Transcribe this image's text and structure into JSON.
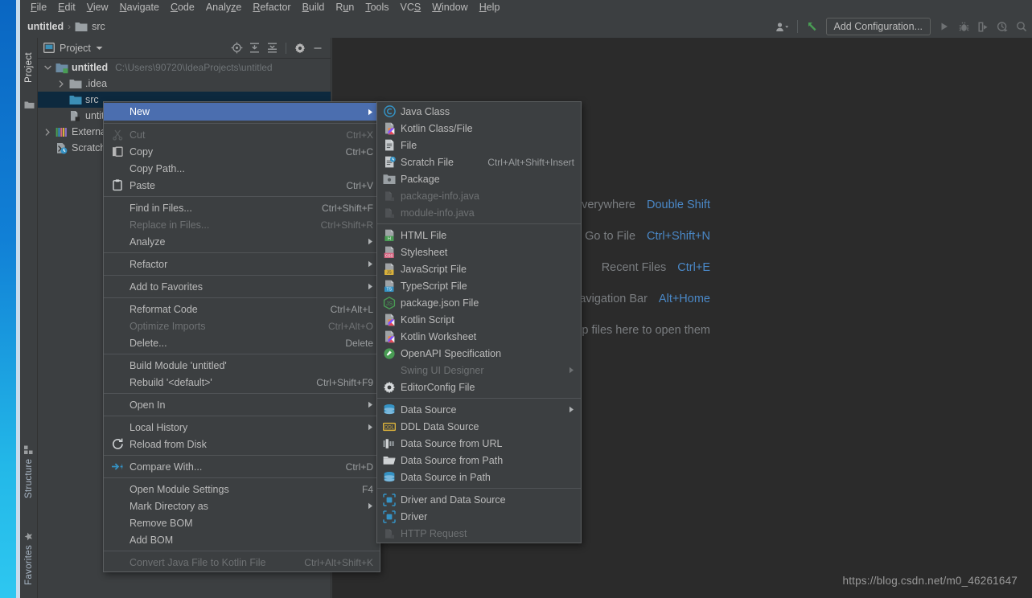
{
  "app": {
    "watermark": "https://blog.csdn.net/m0_46261647"
  },
  "menubar": {
    "items": [
      {
        "label": "File",
        "mnemonic": "F"
      },
      {
        "label": "Edit",
        "mnemonic": "E"
      },
      {
        "label": "View",
        "mnemonic": "V"
      },
      {
        "label": "Navigate",
        "mnemonic": "N"
      },
      {
        "label": "Code",
        "mnemonic": "C"
      },
      {
        "label": "Analyze",
        "mnemonic": "z"
      },
      {
        "label": "Refactor",
        "mnemonic": "R"
      },
      {
        "label": "Build",
        "mnemonic": "B"
      },
      {
        "label": "Run",
        "mnemonic": "u"
      },
      {
        "label": "Tools",
        "mnemonic": "T"
      },
      {
        "label": "VCS",
        "mnemonic": "S"
      },
      {
        "label": "Window",
        "mnemonic": "W"
      },
      {
        "label": "Help",
        "mnemonic": "H"
      }
    ]
  },
  "navbar": {
    "breadcrumb": [
      {
        "label": "untitled",
        "icon": "module-icon"
      },
      {
        "label": "src",
        "icon": "folder-icon"
      }
    ],
    "separator": "›",
    "add_configuration_label": "Add Configuration...",
    "buttons": [
      {
        "name": "user-account-icon"
      },
      {
        "name": "update-project-icon"
      },
      {
        "name": "run-icon"
      },
      {
        "name": "debug-icon"
      },
      {
        "name": "run-with-coverage-icon"
      },
      {
        "name": "profile-icon"
      },
      {
        "name": "search-everywhere-icon"
      }
    ]
  },
  "left_strip": {
    "project_tab": "Project",
    "structure_tab": "Structure",
    "favorites_tab": "Favorites"
  },
  "project_panel": {
    "title": "Project",
    "header_buttons": [
      {
        "name": "select-opened-file-icon"
      },
      {
        "name": "expand-all-icon"
      },
      {
        "name": "collapse-all-icon"
      },
      {
        "name": "settings-gear-icon"
      },
      {
        "name": "hide-icon"
      }
    ],
    "tree": [
      {
        "label": "untitled",
        "path": "C:\\Users\\90720\\IdeaProjects\\untitled",
        "indent": 0,
        "twisty": "open",
        "icon": "module-icon",
        "bold": true,
        "selected": false
      },
      {
        "label": ".idea",
        "path": "",
        "indent": 1,
        "twisty": "closed",
        "icon": "folder-icon",
        "bold": false,
        "selected": false
      },
      {
        "label": "src",
        "path": "",
        "indent": 1,
        "twisty": "none",
        "icon": "source-folder-icon",
        "bold": false,
        "selected": true
      },
      {
        "label": "untitled.iml",
        "path": "",
        "indent": 1,
        "twisty": "none",
        "icon": "iml-icon",
        "bold": false,
        "selected": false
      },
      {
        "label": "External Libraries",
        "path": "",
        "indent": 0,
        "twisty": "closed",
        "icon": "libraries-icon",
        "bold": false,
        "selected": false
      },
      {
        "label": "Scratches and Consoles",
        "path": "",
        "indent": 0,
        "twisty": "none",
        "icon": "scratches-icon",
        "bold": false,
        "selected": false
      }
    ]
  },
  "editor": {
    "hints": [
      {
        "text": "Search Everywhere",
        "key": "Double Shift"
      },
      {
        "text": "Go to File",
        "key": "Ctrl+Shift+N"
      },
      {
        "text": "Recent Files",
        "key": "Ctrl+E"
      },
      {
        "text": "Navigation Bar",
        "key": "Alt+Home"
      },
      {
        "text": "Drop files here to open them",
        "key": ""
      }
    ]
  },
  "context_menu": {
    "items": [
      {
        "label": "New",
        "accel": "",
        "icon": "",
        "arrow": true,
        "selected": true,
        "disabled": false
      },
      {
        "sep": true
      },
      {
        "label": "Cut",
        "accel": "Ctrl+X",
        "icon": "cut-icon",
        "arrow": false,
        "selected": false,
        "disabled": true
      },
      {
        "label": "Copy",
        "accel": "Ctrl+C",
        "icon": "copy-icon",
        "arrow": false,
        "selected": false,
        "disabled": false
      },
      {
        "label": "Copy Path...",
        "accel": "",
        "icon": "",
        "arrow": false,
        "selected": false,
        "disabled": false
      },
      {
        "label": "Paste",
        "accel": "Ctrl+V",
        "icon": "paste-icon",
        "arrow": false,
        "selected": false,
        "disabled": false
      },
      {
        "sep": true
      },
      {
        "label": "Find in Files...",
        "accel": "Ctrl+Shift+F",
        "icon": "",
        "arrow": false,
        "selected": false,
        "disabled": false
      },
      {
        "label": "Replace in Files...",
        "accel": "Ctrl+Shift+R",
        "icon": "",
        "arrow": false,
        "selected": false,
        "disabled": true
      },
      {
        "label": "Analyze",
        "accel": "",
        "icon": "",
        "arrow": true,
        "selected": false,
        "disabled": false
      },
      {
        "sep": true
      },
      {
        "label": "Refactor",
        "accel": "",
        "icon": "",
        "arrow": true,
        "selected": false,
        "disabled": false
      },
      {
        "sep": true
      },
      {
        "label": "Add to Favorites",
        "accel": "",
        "icon": "",
        "arrow": true,
        "selected": false,
        "disabled": false
      },
      {
        "sep": true
      },
      {
        "label": "Reformat Code",
        "accel": "Ctrl+Alt+L",
        "icon": "",
        "arrow": false,
        "selected": false,
        "disabled": false
      },
      {
        "label": "Optimize Imports",
        "accel": "Ctrl+Alt+O",
        "icon": "",
        "arrow": false,
        "selected": false,
        "disabled": true
      },
      {
        "label": "Delete...",
        "accel": "Delete",
        "icon": "",
        "arrow": false,
        "selected": false,
        "disabled": false
      },
      {
        "sep": true
      },
      {
        "label": "Build Module 'untitled'",
        "accel": "",
        "icon": "",
        "arrow": false,
        "selected": false,
        "disabled": false
      },
      {
        "label": "Rebuild '<default>'",
        "accel": "Ctrl+Shift+F9",
        "icon": "",
        "arrow": false,
        "selected": false,
        "disabled": false
      },
      {
        "sep": true
      },
      {
        "label": "Open In",
        "accel": "",
        "icon": "",
        "arrow": true,
        "selected": false,
        "disabled": false
      },
      {
        "sep": true
      },
      {
        "label": "Local History",
        "accel": "",
        "icon": "",
        "arrow": true,
        "selected": false,
        "disabled": false
      },
      {
        "label": "Reload from Disk",
        "accel": "",
        "icon": "reload-icon",
        "arrow": false,
        "selected": false,
        "disabled": false
      },
      {
        "sep": true
      },
      {
        "label": "Compare With...",
        "accel": "Ctrl+D",
        "icon": "compare-icon",
        "arrow": false,
        "selected": false,
        "disabled": false
      },
      {
        "sep": true
      },
      {
        "label": "Open Module Settings",
        "accel": "F4",
        "icon": "",
        "arrow": false,
        "selected": false,
        "disabled": false
      },
      {
        "label": "Mark Directory as",
        "accel": "",
        "icon": "",
        "arrow": true,
        "selected": false,
        "disabled": false
      },
      {
        "label": "Remove BOM",
        "accel": "",
        "icon": "",
        "arrow": false,
        "selected": false,
        "disabled": false
      },
      {
        "label": "Add BOM",
        "accel": "",
        "icon": "",
        "arrow": false,
        "selected": false,
        "disabled": false
      },
      {
        "sep": true
      },
      {
        "label": "Convert Java File to Kotlin File",
        "accel": "Ctrl+Alt+Shift+K",
        "icon": "",
        "arrow": false,
        "selected": false,
        "disabled": true
      }
    ]
  },
  "new_submenu": {
    "items": [
      {
        "label": "Java Class",
        "accel": "",
        "icon": "java-class-icon",
        "arrow": false,
        "disabled": false
      },
      {
        "label": "Kotlin Class/File",
        "accel": "",
        "icon": "kotlin-file-icon",
        "arrow": false,
        "disabled": false
      },
      {
        "label": "File",
        "accel": "",
        "icon": "file-icon",
        "arrow": false,
        "disabled": false
      },
      {
        "label": "Scratch File",
        "accel": "Ctrl+Alt+Shift+Insert",
        "icon": "scratch-file-icon",
        "arrow": false,
        "disabled": false
      },
      {
        "label": "Package",
        "accel": "",
        "icon": "package-icon",
        "arrow": false,
        "disabled": false
      },
      {
        "label": "package-info.java",
        "accel": "",
        "icon": "java-dim-icon",
        "arrow": false,
        "disabled": true
      },
      {
        "label": "module-info.java",
        "accel": "",
        "icon": "java-dim-icon",
        "arrow": false,
        "disabled": true
      },
      {
        "sep": true
      },
      {
        "label": "HTML File",
        "accel": "",
        "icon": "html-file-icon",
        "arrow": false,
        "disabled": false
      },
      {
        "label": "Stylesheet",
        "accel": "",
        "icon": "css-file-icon",
        "arrow": false,
        "disabled": false
      },
      {
        "label": "JavaScript File",
        "accel": "",
        "icon": "js-file-icon",
        "arrow": false,
        "disabled": false
      },
      {
        "label": "TypeScript File",
        "accel": "",
        "icon": "ts-file-icon",
        "arrow": false,
        "disabled": false
      },
      {
        "label": "package.json File",
        "accel": "",
        "icon": "nodejs-icon",
        "arrow": false,
        "disabled": false
      },
      {
        "label": "Kotlin Script",
        "accel": "",
        "icon": "kotlin-file-icon",
        "arrow": false,
        "disabled": false
      },
      {
        "label": "Kotlin Worksheet",
        "accel": "",
        "icon": "kotlin-file-icon",
        "arrow": false,
        "disabled": false
      },
      {
        "label": "OpenAPI Specification",
        "accel": "",
        "icon": "openapi-icon",
        "arrow": false,
        "disabled": false
      },
      {
        "label": "Swing UI Designer",
        "accel": "",
        "icon": "",
        "arrow": true,
        "disabled": true
      },
      {
        "label": "EditorConfig File",
        "accel": "",
        "icon": "editorconfig-icon",
        "arrow": false,
        "disabled": false
      },
      {
        "sep": true
      },
      {
        "label": "Data Source",
        "accel": "",
        "icon": "datasource-icon",
        "arrow": true,
        "disabled": false
      },
      {
        "label": "DDL Data Source",
        "accel": "",
        "icon": "ddl-icon",
        "arrow": false,
        "disabled": false
      },
      {
        "label": "Data Source from URL",
        "accel": "",
        "icon": "ds-url-icon",
        "arrow": false,
        "disabled": false
      },
      {
        "label": "Data Source from Path",
        "accel": "",
        "icon": "ds-path-icon",
        "arrow": false,
        "disabled": false
      },
      {
        "label": "Data Source in Path",
        "accel": "",
        "icon": "datasource-icon",
        "arrow": false,
        "disabled": false
      },
      {
        "sep": true
      },
      {
        "label": "Driver and Data Source",
        "accel": "",
        "icon": "driver-icon",
        "arrow": false,
        "disabled": false
      },
      {
        "label": "Driver",
        "accel": "",
        "icon": "driver-icon",
        "arrow": false,
        "disabled": false
      },
      {
        "label": "HTTP Request",
        "accel": "",
        "icon": "java-dim-icon",
        "arrow": false,
        "disabled": true
      }
    ]
  },
  "colors": {
    "menu_bg": "#3c3f41",
    "editor_bg": "#2b2b2b",
    "selection_blue": "#4b6eaf",
    "tree_selection": "#0d293e",
    "hint_key": "#4a88c7",
    "text": "#bbbbbb"
  }
}
